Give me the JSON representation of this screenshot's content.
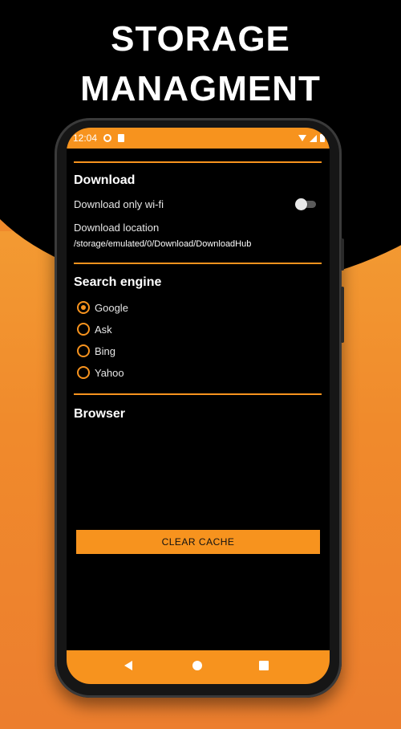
{
  "promo": {
    "line1": "STORAGE",
    "line2": "MANAGMENT"
  },
  "status_bar": {
    "time": "12:04",
    "icons": [
      "sync-icon",
      "sd-card-icon",
      "wifi-icon",
      "signal-icon",
      "battery-icon"
    ]
  },
  "download": {
    "title": "Download",
    "wifi_only_label": "Download only wi-fi",
    "wifi_only_enabled": false,
    "location_label": "Download location",
    "location_path": "/storage/emulated/0/Download/DownloadHub"
  },
  "search_engine": {
    "title": "Search engine",
    "options": [
      "Google",
      "Ask",
      "Bing",
      "Yahoo"
    ],
    "selected": "Google"
  },
  "browser": {
    "title": "Browser",
    "clear_cache_label": "CLEAR CACHE"
  },
  "nav": {
    "icons": [
      "back-icon",
      "home-icon",
      "recents-icon"
    ]
  },
  "colors": {
    "accent": "#f7931e",
    "background": "#000000",
    "promo_background": "#f08a2c"
  }
}
